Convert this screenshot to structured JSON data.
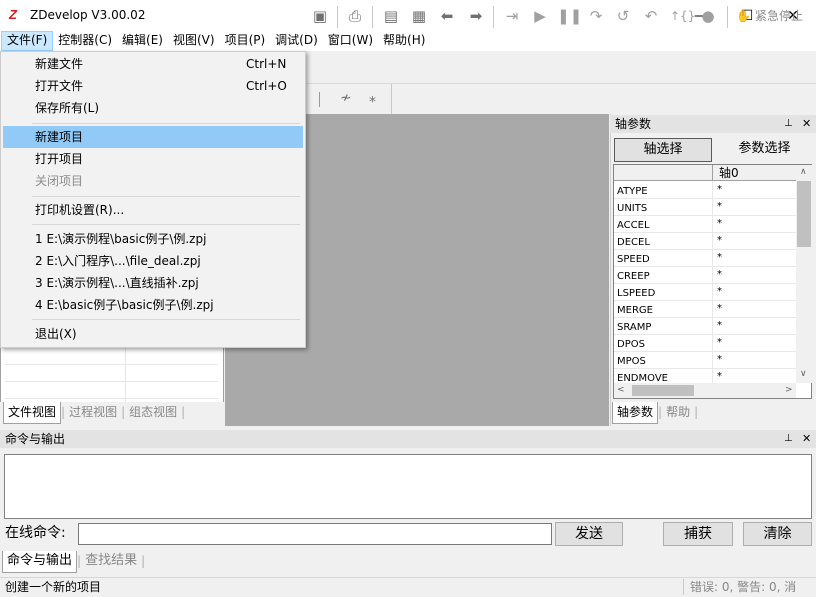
{
  "window": {
    "title": "ZDevelop V3.00.02",
    "logo": "Z",
    "minimize": "—",
    "maximize": "☐",
    "close": "✕"
  },
  "menubar": [
    {
      "label": "文件(F)"
    },
    {
      "label": "控制器(C)"
    },
    {
      "label": "编辑(E)"
    },
    {
      "label": "视图(V)"
    },
    {
      "label": "项目(P)"
    },
    {
      "label": "调试(D)"
    },
    {
      "label": "窗口(W)"
    },
    {
      "label": "帮助(H)"
    }
  ],
  "toolbar": {
    "estop_label": "紧急停止"
  },
  "file_menu": {
    "new_file": "新建文件",
    "new_file_shortcut": "Ctrl+N",
    "open_file": "打开文件",
    "open_file_shortcut": "Ctrl+O",
    "save_all": "保存所有(L)",
    "new_project": "新建项目",
    "open_project": "打开项目",
    "close_project": "关闭项目",
    "printer_setup": "打印机设置(R)...",
    "recent": [
      "1 E:\\演示例程\\basic例子\\例.zpj",
      "2 E:\\入门程序\\...\\file_deal.zpj",
      "3 E:\\演示例程\\...\\直线插补.zpj",
      "4 E:\\basic例子\\basic例子\\例.zpj"
    ],
    "exit": "退出(X)"
  },
  "left_tabs": [
    "文件视图",
    "过程视图",
    "组态视图"
  ],
  "axis_panel": {
    "title": "轴参数",
    "pin": "⊥",
    "close": "✕",
    "axis_select_btn": "轴选择",
    "param_select_btn": "参数选择",
    "column": "轴0",
    "params": [
      {
        "name": "ATYPE",
        "value": "*"
      },
      {
        "name": "UNITS",
        "value": "*"
      },
      {
        "name": "ACCEL",
        "value": "*"
      },
      {
        "name": "DECEL",
        "value": "*"
      },
      {
        "name": "SPEED",
        "value": "*"
      },
      {
        "name": "CREEP",
        "value": "*"
      },
      {
        "name": "LSPEED",
        "value": "*"
      },
      {
        "name": "MERGE",
        "value": "*"
      },
      {
        "name": "SRAMP",
        "value": "*"
      },
      {
        "name": "DPOS",
        "value": "*"
      },
      {
        "name": "MPOS",
        "value": "*"
      },
      {
        "name": "ENDMOVE",
        "value": "*"
      }
    ],
    "tabs": [
      "轴参数",
      "帮助"
    ]
  },
  "command_panel": {
    "title": "命令与输出",
    "online_label": "在线命令:",
    "input_value": "",
    "send": "发送",
    "capture": "捕获",
    "clear": "清除",
    "tabs": [
      "命令与输出",
      "查找结果"
    ]
  },
  "status": {
    "left": "创建一个新的项目",
    "right": "错误: 0, 警告: 0, 消"
  }
}
